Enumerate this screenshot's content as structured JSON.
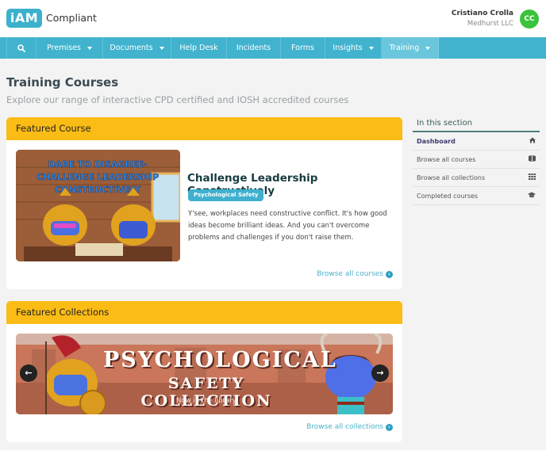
{
  "header": {
    "logo_mark": "iAM",
    "logo_text": "Compliant",
    "user_name": "Cristiano Crolla",
    "user_org": "Medhurst LLC",
    "avatar_initials": "CC",
    "avatar_color": "#3bc33b"
  },
  "nav": {
    "search_icon": "⌕",
    "items": [
      {
        "label": "Premises",
        "dropdown": true
      },
      {
        "label": "Documents",
        "dropdown": true
      },
      {
        "label": "Help Desk",
        "dropdown": false
      },
      {
        "label": "Incidents",
        "dropdown": false
      },
      {
        "label": "Forms",
        "dropdown": false
      },
      {
        "label": "Insights",
        "dropdown": true
      },
      {
        "label": "Training",
        "dropdown": true,
        "active": true
      }
    ],
    "accent": "#41b3ce"
  },
  "page": {
    "title": "Training Courses",
    "subtitle": "Explore our range of interactive CPD certified and IOSH accredited courses"
  },
  "featured_course": {
    "heading": "Featured Course",
    "image_caption": "DARE TO DISAGREE- CHALLENGE LEADERSHIP CONSTRUCTIVELY",
    "title": "Challenge Leadership Constructively",
    "tag": "Psychological Safety",
    "description": "Y'see, workplaces need constructive conflict. It's how good ideas become brilliant ideas. And you can't overcome problems and challenges if you don't raise them.",
    "link_label": "Browse all courses"
  },
  "featured_collections": {
    "heading": "Featured Collections",
    "banner_line1": "PSYCHOLOGICAL",
    "banner_line2": "SAFETY COLLECTION",
    "banner_sub": "Now in the library",
    "prev_icon": "←",
    "next_icon": "→",
    "link_label": "Browse all collections"
  },
  "sidebar": {
    "title": "In this section",
    "items": [
      {
        "label": "Dashboard",
        "icon": "⌂",
        "active": true
      },
      {
        "label": "Browse all courses",
        "icon": "▤"
      },
      {
        "label": "Browse all collections",
        "icon": "▦"
      },
      {
        "label": "Completed courses",
        "icon": "🎓"
      }
    ]
  },
  "colors": {
    "section_header": "#fbbc16",
    "link": "#4bb1cc",
    "badge": "#3fb1ce"
  }
}
